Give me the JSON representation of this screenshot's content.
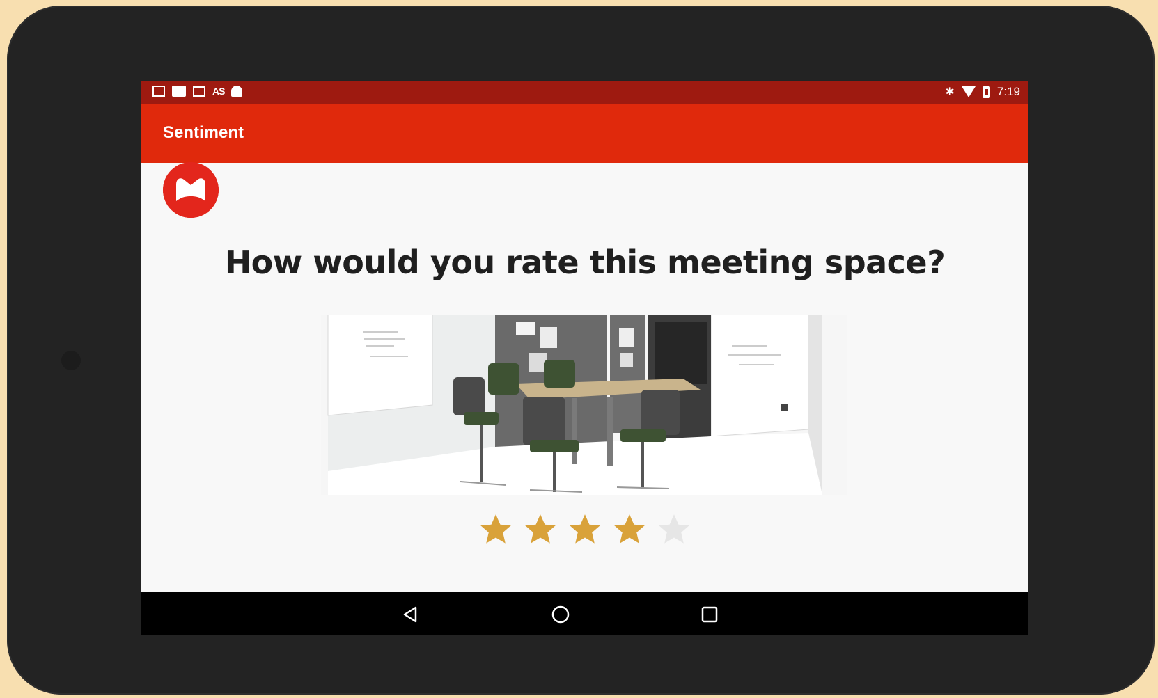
{
  "statusbar": {
    "left_icons": [
      "image-icon",
      "video-icon",
      "calendar-icon",
      "as-icon",
      "android-icon"
    ],
    "as_label": "AS",
    "right_icons": [
      "bluetooth-icon",
      "wifi-icon",
      "battery-icon"
    ],
    "time": "7:19"
  },
  "appbar": {
    "title": "Sentiment",
    "color": "#e0290c"
  },
  "logo": {
    "name": "brand-logo"
  },
  "main": {
    "question": "How would you rate this meeting space?",
    "image": "meeting-room-photo"
  },
  "rating": {
    "value": 4,
    "max": 5,
    "filled_color": "#d9a23a",
    "empty_color": "#e6e6e6"
  },
  "navbar": {
    "buttons": [
      "back-icon",
      "home-icon",
      "recents-icon"
    ]
  }
}
